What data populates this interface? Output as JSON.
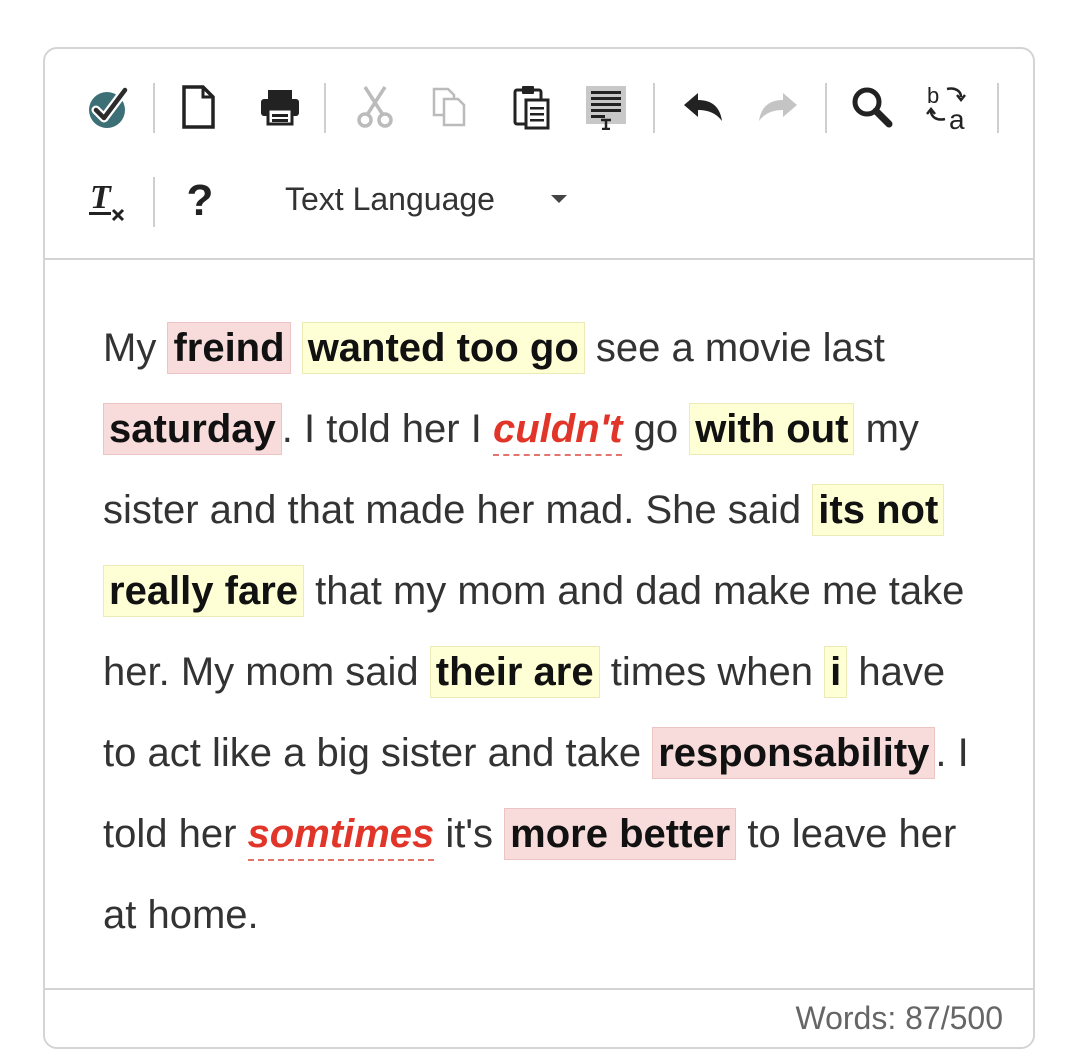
{
  "toolbar": {
    "icons": [
      "spellcheck-icon",
      "new-document-icon",
      "print-icon",
      "cut-icon",
      "copy-icon",
      "paste-icon",
      "paste-text-icon",
      "undo-icon",
      "redo-icon",
      "find-icon",
      "replace-icon",
      "clear-formatting-icon",
      "help-icon"
    ],
    "help_label": "?",
    "language_label": "Text Language"
  },
  "content": {
    "segments": [
      {
        "t": "My "
      },
      {
        "t": "freind",
        "c": "pink"
      },
      {
        "t": " "
      },
      {
        "t": "wanted too go",
        "c": "yellow"
      },
      {
        "t": " see a movie last "
      },
      {
        "t": "saturday",
        "c": "pink"
      },
      {
        "t": ". I told her I "
      },
      {
        "t": "culdn't",
        "c": "red"
      },
      {
        "t": " go "
      },
      {
        "t": "with out",
        "c": "yellow"
      },
      {
        "t": " my sister and that made her mad. She said "
      },
      {
        "t": "its not",
        "c": "yellow"
      },
      {
        "t": " "
      },
      {
        "t": "really fare",
        "c": "yellow"
      },
      {
        "t": " that my mom and dad make me take her. My mom said "
      },
      {
        "t": "their are",
        "c": "yellow"
      },
      {
        "t": " times when "
      },
      {
        "t": "i",
        "c": "yellow"
      },
      {
        "t": " have to act like a big sister and take "
      },
      {
        "t": "responsability",
        "c": "pink"
      },
      {
        "t": ". I told her "
      },
      {
        "t": "somtimes",
        "c": "red"
      },
      {
        "t": " it's "
      },
      {
        "t": "more better",
        "c": "pink"
      },
      {
        "t": " to leave her at home."
      }
    ]
  },
  "footer": {
    "word_count": "Words: 87/500"
  },
  "colors": {
    "accent": "#3d6f76",
    "pink_highlight": "#f8dcdc",
    "yellow_highlight": "#ffffd6",
    "spelling_red": "#e03528",
    "disabled_icon": "#bbbbbb"
  }
}
